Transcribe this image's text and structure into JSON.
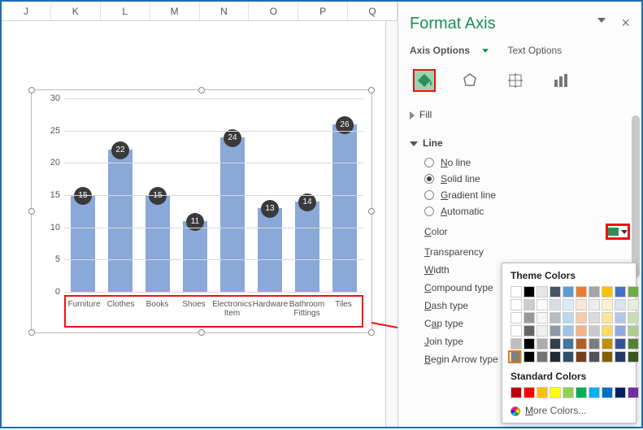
{
  "columns": [
    "J",
    "K",
    "L",
    "M",
    "N",
    "O",
    "P",
    "Q"
  ],
  "pane": {
    "title": "Format Axis",
    "sub_axis": "Axis Options",
    "sub_text": "Text Options",
    "sect_fill": "Fill",
    "sect_line": "Line",
    "opts": {
      "none": "No line",
      "solid": "Solid line",
      "grad": "Gradient line",
      "auto": "Automatic"
    },
    "params": {
      "color": "Color",
      "trans": "Transparency",
      "width": "Width",
      "compound": "Compound type",
      "dash": "Dash type",
      "cap": "Cap type",
      "join": "Join type",
      "barrow": "Begin Arrow type"
    },
    "popup": {
      "theme": "Theme Colors",
      "standard": "Standard Colors",
      "more": "More Colors...",
      "theme_colors": [
        "#ffffff",
        "#000000",
        "#e7e6e6",
        "#44546a",
        "#5b9bd5",
        "#ed7d31",
        "#a5a5a5",
        "#ffc000",
        "#4472c4",
        "#70ad47"
      ],
      "std_colors": [
        "#c00000",
        "#ff0000",
        "#ffc000",
        "#ffff00",
        "#92d050",
        "#00b050",
        "#00b0f0",
        "#0070c0",
        "#002060",
        "#7030a0"
      ]
    }
  },
  "chart_data": {
    "type": "bar",
    "title": "",
    "xlabel": "",
    "ylabel": "",
    "ylim": [
      0,
      30
    ],
    "yticks": [
      0,
      5,
      10,
      15,
      20,
      25,
      30
    ],
    "categories": [
      "Furniture",
      "Clothes",
      "Books",
      "Shoes",
      "Electronics Item",
      "Hardware",
      "Bathroom Fittings",
      "Tiles"
    ],
    "values": [
      15,
      22,
      15,
      11,
      24,
      13,
      14,
      26
    ],
    "bar_color": "#8aa8d8",
    "label_bg": "#3a3a3a"
  }
}
